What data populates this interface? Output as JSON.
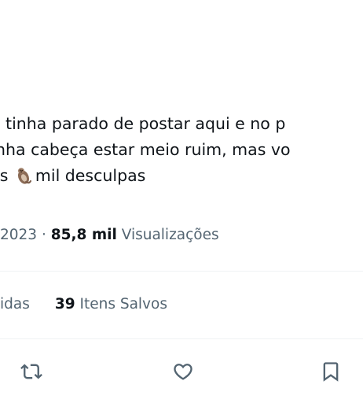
{
  "tweet": {
    "line1": ", tinha parado de postar aqui  e no p",
    "line2": "nha cabeça estar meio ruim, mas vo",
    "line3_prefix": "is",
    "emoji": "otter-emoji",
    "line3_suffix": "mil desculpas"
  },
  "meta": {
    "date": "2023",
    "separator": "·",
    "views_count": "85,8 mil",
    "views_label": "Visualizações"
  },
  "stats": {
    "partial_label": "idas",
    "saved_count": "39",
    "saved_label": "Itens Salvos"
  },
  "actions": [
    {
      "icon": "retweet-icon"
    },
    {
      "icon": "heart-icon"
    },
    {
      "icon": "bookmark-icon"
    }
  ],
  "colors": {
    "text": "#0f1419",
    "secondary": "#536471",
    "divider": "#eff3f4"
  }
}
